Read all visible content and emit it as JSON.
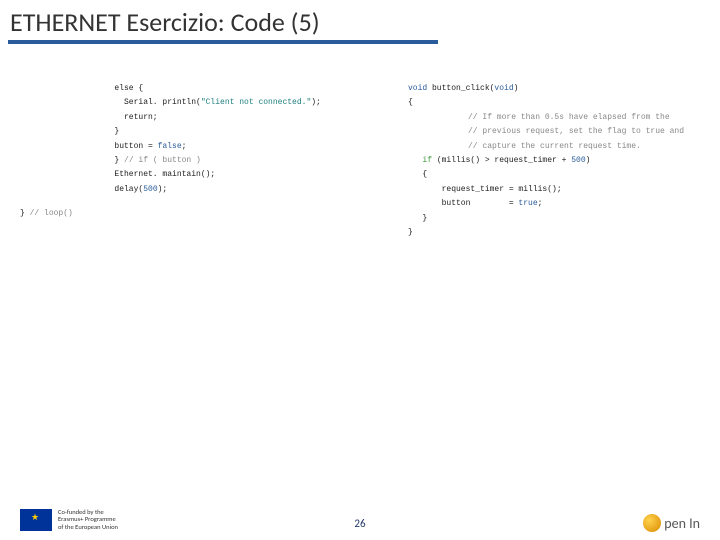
{
  "slide": {
    "title": "ETHERNET Esercizio: Code (5)",
    "page_number": "26"
  },
  "code_left": {
    "l1": "   else {",
    "l2a": "     Serial. println(",
    "l2b": "\"Client not connected.\"",
    "l2c": ");",
    "l3": "     return;",
    "l4": "   }",
    "l5a": "   button = ",
    "l5b": "false",
    "l5c": ";",
    "l6a": "   } ",
    "l6b": "// if ( button )",
    "l7": "   Ethernet. maintain();",
    "l8a": "   delay(",
    "l8b": "500",
    "l8c": ");",
    "l9a": "} ",
    "l9b": "// loop()"
  },
  "code_right": {
    "l1a": "void",
    "l1b": " button_click(",
    "l1c": "void",
    "l1d": ")",
    "l2": "{",
    "c1": "// If more than 0.5s have elapsed from the",
    "c2": "// previous request, set the flag to true and",
    "c3": "// capture the current request time.",
    "l3a": "   if",
    "l3b": " (millis() > request_timer + ",
    "l3c": "500",
    "l3d": ")",
    "l4": "   {",
    "l5": "       request_timer = millis();",
    "l6a": "       button        = ",
    "l6b": "true",
    "l6c": ";",
    "l7": "   }",
    "l8": "}"
  },
  "footer": {
    "eu_line1": "Co-funded by the",
    "eu_line2": "Erasmus+ Programme",
    "eu_line3": "of the European Union",
    "right_logo_text": "pen In"
  }
}
